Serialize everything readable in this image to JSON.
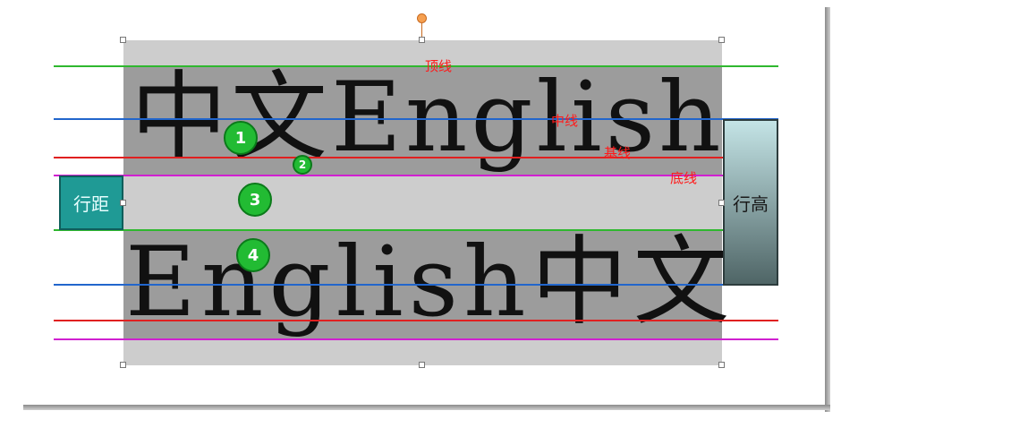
{
  "lines": [
    {
      "text": "中文English"
    },
    {
      "text": "English中文"
    }
  ],
  "annotations": {
    "top_line": "顶线",
    "mid_line": "中线",
    "base_line": "基线",
    "bottom_line": "底线"
  },
  "badges": [
    "1",
    "2",
    "3",
    "4"
  ],
  "labels": {
    "leading": "行距",
    "line_height": "行高"
  },
  "colors": {
    "top_line": "#2fb82f",
    "mid_line": "#2266cc",
    "base_line": "#e02020",
    "bottom_line": "#d020d0",
    "annotation": "#ff1a1a",
    "badge": "#22bb33"
  }
}
